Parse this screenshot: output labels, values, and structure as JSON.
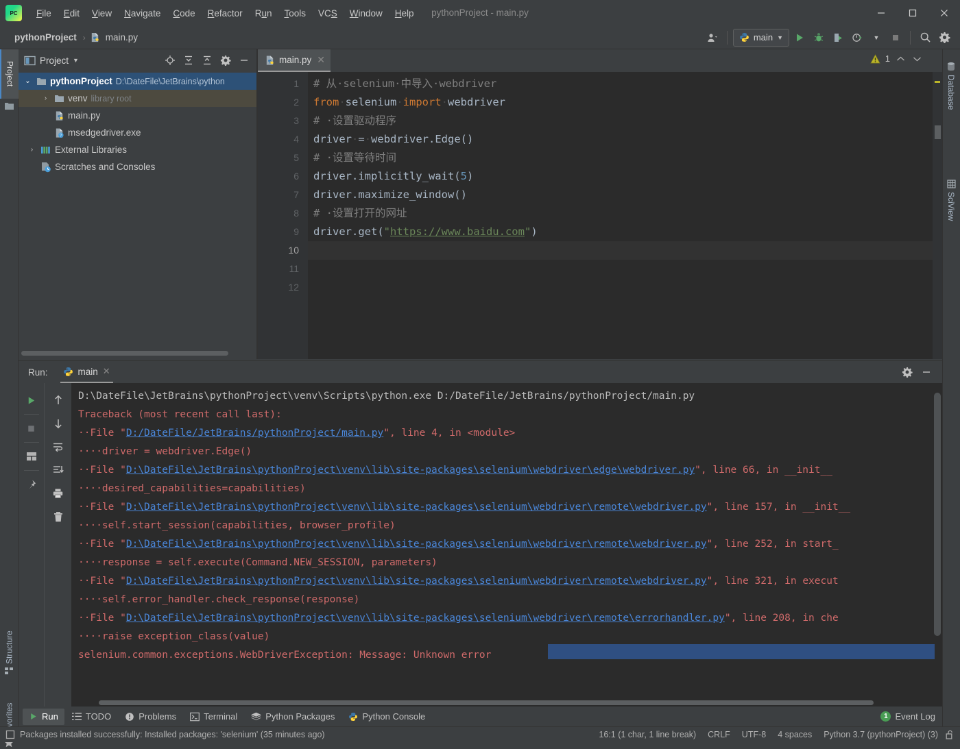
{
  "window": {
    "title": "pythonProject - main.py",
    "logo_text": "PC",
    "minimize": "─",
    "maximize": "☐",
    "close": "✕"
  },
  "menubar": [
    {
      "label": "File",
      "mnemonic": "F"
    },
    {
      "label": "Edit",
      "mnemonic": "E"
    },
    {
      "label": "View",
      "mnemonic": "V"
    },
    {
      "label": "Navigate",
      "mnemonic": "N"
    },
    {
      "label": "Code",
      "mnemonic": "C"
    },
    {
      "label": "Refactor",
      "mnemonic": "R"
    },
    {
      "label": "Run",
      "mnemonic": "u"
    },
    {
      "label": "Tools",
      "mnemonic": "T"
    },
    {
      "label": "VCS",
      "mnemonic": "S"
    },
    {
      "label": "Window",
      "mnemonic": "W"
    },
    {
      "label": "Help",
      "mnemonic": "H"
    }
  ],
  "navbar": {
    "breadcrumbs": [
      "pythonProject",
      "main.py"
    ],
    "separator": "›",
    "run_config": "main",
    "icons": [
      "user-avatar-icon",
      "chevron-down-icon",
      "run-icon",
      "debug-icon",
      "run-coverage-icon",
      "profile-icon",
      "chevron-down-icon",
      "stop-icon",
      "search-icon",
      "settings-gear-icon"
    ]
  },
  "left_stripe": {
    "project": "Project",
    "structure": "Structure",
    "favorites": "Favorites"
  },
  "right_stripe": {
    "database": "Database",
    "sciview": "SciView"
  },
  "project_panel": {
    "title": "Project",
    "header_icons": [
      "locate-icon",
      "expand-all-icon",
      "collapse-all-icon",
      "settings-gear-icon",
      "hide-icon"
    ],
    "tree": [
      {
        "label": "pythonProject",
        "sub": "D:\\DateFile\\JetBrains\\python",
        "depth": 0,
        "twisty": "expanded",
        "icon": "folder-icon",
        "state": "selected",
        "bold": true
      },
      {
        "label": "venv",
        "sub": "library root",
        "depth": 1,
        "twisty": "collapsed",
        "icon": "folder-icon",
        "state": "highlight",
        "bold": false
      },
      {
        "label": "main.py",
        "sub": "",
        "depth": 2,
        "twisty": "none",
        "icon": "python-file-icon",
        "state": "",
        "bold": false
      },
      {
        "label": "msedgedriver.exe",
        "sub": "",
        "depth": 2,
        "twisty": "none",
        "icon": "unknown-file-icon",
        "state": "",
        "bold": false
      },
      {
        "label": "External Libraries",
        "sub": "",
        "depth": 0,
        "twisty": "collapsed",
        "icon": "libraries-icon",
        "state": "",
        "bold": false
      },
      {
        "label": "Scratches and Consoles",
        "sub": "",
        "depth": 0,
        "twisty": "none",
        "icon": "scratches-icon",
        "state": "",
        "bold": false
      }
    ]
  },
  "editor": {
    "tab": {
      "label": "main.py",
      "icon": "python-file-icon",
      "close": "✕"
    },
    "warning_count": "1",
    "warning_icon": "warning-triangle-icon",
    "chevron_up": "⌃",
    "chevron_down": "⌄",
    "line_numbers": [
      "1",
      "2",
      "3",
      "4",
      "5",
      "6",
      "7",
      "8",
      "9",
      "10",
      "11",
      "12"
    ],
    "current_line": "10",
    "lines": [
      {
        "n": 1,
        "tokens": [
          {
            "t": "# 从·selenium·中导入·webdriver",
            "c": "cm"
          }
        ]
      },
      {
        "n": 2,
        "tokens": [
          {
            "t": "from",
            "c": "kw"
          },
          {
            "t": "·",
            "c": "dot"
          },
          {
            "t": "selenium",
            "c": "id"
          },
          {
            "t": "·",
            "c": "dot"
          },
          {
            "t": "import",
            "c": "kw"
          },
          {
            "t": "·",
            "c": "dot"
          },
          {
            "t": "webdriver",
            "c": "id"
          }
        ]
      },
      {
        "n": 3,
        "tokens": [
          {
            "t": "# ·设置驱动程序",
            "c": "cm"
          }
        ]
      },
      {
        "n": 4,
        "tokens": [
          {
            "t": "driver",
            "c": "id"
          },
          {
            "t": "·",
            "c": "dot"
          },
          {
            "t": "=",
            "c": "id"
          },
          {
            "t": "·",
            "c": "dot"
          },
          {
            "t": "webdriver.Edge()",
            "c": "id"
          }
        ]
      },
      {
        "n": 5,
        "tokens": [
          {
            "t": "# ·设置等待时间",
            "c": "cm"
          }
        ]
      },
      {
        "n": 6,
        "tokens": [
          {
            "t": "driver.implicitly_wait(",
            "c": "id"
          },
          {
            "t": "5",
            "c": "num"
          },
          {
            "t": ")",
            "c": "id"
          }
        ]
      },
      {
        "n": 7,
        "tokens": [
          {
            "t": "driver.maximize_window()",
            "c": "id"
          }
        ]
      },
      {
        "n": 8,
        "tokens": [
          {
            "t": "# ·设置打开的网址",
            "c": "cm"
          }
        ]
      },
      {
        "n": 9,
        "tokens": [
          {
            "t": "driver.get(",
            "c": "id"
          },
          {
            "t": "\"",
            "c": "str"
          },
          {
            "t": "https://www.baidu.com",
            "c": "lnk"
          },
          {
            "t": "\"",
            "c": "str"
          },
          {
            "t": ")",
            "c": "id"
          }
        ]
      },
      {
        "n": 10,
        "tokens": []
      },
      {
        "n": 11,
        "tokens": []
      },
      {
        "n": 12,
        "tokens": []
      }
    ]
  },
  "run_panel": {
    "label": "Run:",
    "tab": {
      "label": "main",
      "icon": "python-icon",
      "close": "✕"
    },
    "header_icons": [
      "settings-gear-icon",
      "hide-icon"
    ],
    "toolbar_left": [
      "rerun-icon",
      "stop-icon",
      "restore-layout-icon",
      "pin-icon"
    ],
    "toolbar_right": [
      "up-arrow-icon",
      "down-arrow-icon",
      "soft-wrap-icon",
      "scroll-to-end-icon",
      "print-icon",
      "trash-icon"
    ],
    "console": [
      {
        "segs": [
          {
            "t": "D:\\DateFile\\JetBrains\\pythonProject\\venv\\Scripts\\python.exe D:/DateFile/JetBrains/pythonProject/main.py",
            "c": "c-out"
          }
        ]
      },
      {
        "segs": [
          {
            "t": "Traceback (most recent call last):",
            "c": "c-err"
          }
        ]
      },
      {
        "segs": [
          {
            "t": "··File \"",
            "c": "c-err"
          },
          {
            "t": "D:/DateFile/JetBrains/pythonProject/main.py",
            "c": "c-link"
          },
          {
            "t": "\", line 4, in <module>",
            "c": "c-err"
          }
        ]
      },
      {
        "segs": [
          {
            "t": "····driver = webdriver.Edge()",
            "c": "c-err"
          }
        ]
      },
      {
        "segs": [
          {
            "t": "··File \"",
            "c": "c-err"
          },
          {
            "t": "D:\\DateFile\\JetBrains\\pythonProject\\venv\\lib\\site-packages\\selenium\\webdriver\\edge\\webdriver.py",
            "c": "c-link"
          },
          {
            "t": "\", line 66, in __init__",
            "c": "c-err"
          }
        ]
      },
      {
        "segs": [
          {
            "t": "····desired_capabilities=capabilities)",
            "c": "c-err"
          }
        ]
      },
      {
        "segs": [
          {
            "t": "··File \"",
            "c": "c-err"
          },
          {
            "t": "D:\\DateFile\\JetBrains\\pythonProject\\venv\\lib\\site-packages\\selenium\\webdriver\\remote\\webdriver.py",
            "c": "c-link"
          },
          {
            "t": "\", line 157, in __init__",
            "c": "c-err"
          }
        ]
      },
      {
        "segs": [
          {
            "t": "····self.start_session(capabilities, browser_profile)",
            "c": "c-err"
          }
        ]
      },
      {
        "segs": [
          {
            "t": "··File \"",
            "c": "c-err"
          },
          {
            "t": "D:\\DateFile\\JetBrains\\pythonProject\\venv\\lib\\site-packages\\selenium\\webdriver\\remote\\webdriver.py",
            "c": "c-link"
          },
          {
            "t": "\", line 252, in start_",
            "c": "c-err"
          }
        ]
      },
      {
        "segs": [
          {
            "t": "····response = self.execute(Command.NEW_SESSION, parameters)",
            "c": "c-err"
          }
        ]
      },
      {
        "segs": [
          {
            "t": "··File \"",
            "c": "c-err"
          },
          {
            "t": "D:\\DateFile\\JetBrains\\pythonProject\\venv\\lib\\site-packages\\selenium\\webdriver\\remote\\webdriver.py",
            "c": "c-link"
          },
          {
            "t": "\", line 321, in execut",
            "c": "c-err"
          }
        ]
      },
      {
        "segs": [
          {
            "t": "····self.error_handler.check_response(response)",
            "c": "c-err"
          }
        ]
      },
      {
        "segs": [
          {
            "t": "··File \"",
            "c": "c-err"
          },
          {
            "t": "D:\\DateFile\\JetBrains\\pythonProject\\venv\\lib\\site-packages\\selenium\\webdriver\\remote\\errorhandler.py",
            "c": "c-link"
          },
          {
            "t": "\", line 208, in che",
            "c": "c-err"
          }
        ]
      },
      {
        "segs": [
          {
            "t": "····raise exception_class(value)",
            "c": "c-err"
          }
        ]
      },
      {
        "segs": [
          {
            "t": "selenium.common.exceptions.WebDriverException: Message: Unknown error",
            "c": "c-err"
          }
        ]
      }
    ]
  },
  "bottom_bar": {
    "buttons": [
      {
        "label": "Run",
        "icon": "run-icon",
        "active": true
      },
      {
        "label": "TODO",
        "icon": "todo-icon",
        "active": false
      },
      {
        "label": "Problems",
        "icon": "problems-icon",
        "active": false
      },
      {
        "label": "Terminal",
        "icon": "terminal-icon",
        "active": false
      },
      {
        "label": "Python Packages",
        "icon": "packages-icon",
        "active": false
      },
      {
        "label": "Python Console",
        "icon": "python-icon",
        "active": false
      }
    ],
    "event_log": {
      "label": "Event Log",
      "badge": "1"
    }
  },
  "statusbar": {
    "message": "Packages installed successfully: Installed packages: 'selenium' (35 minutes ago)",
    "message_icon": "notification-icon",
    "caret_position": "16:1 (1 char, 1 line break)",
    "line_separator": "CRLF",
    "encoding": "UTF-8",
    "indent": "4 spaces",
    "interpreter": "Python 3.7 (pythonProject) (3)",
    "lock_icon": "unlocked-icon"
  },
  "colors": {
    "accent_blue": "#2d5177",
    "selection_blue": "#2f4f82",
    "error_red": "#cf6a6a",
    "link_blue": "#4a86d8",
    "string_green": "#6a8759",
    "keyword_orange": "#cc7832",
    "number_blue": "#6897bb",
    "badge_green": "#499c54",
    "warning_yellow": "#bbb529",
    "editor_bg": "#2b2b2b",
    "panel_bg": "#3c3f41"
  }
}
